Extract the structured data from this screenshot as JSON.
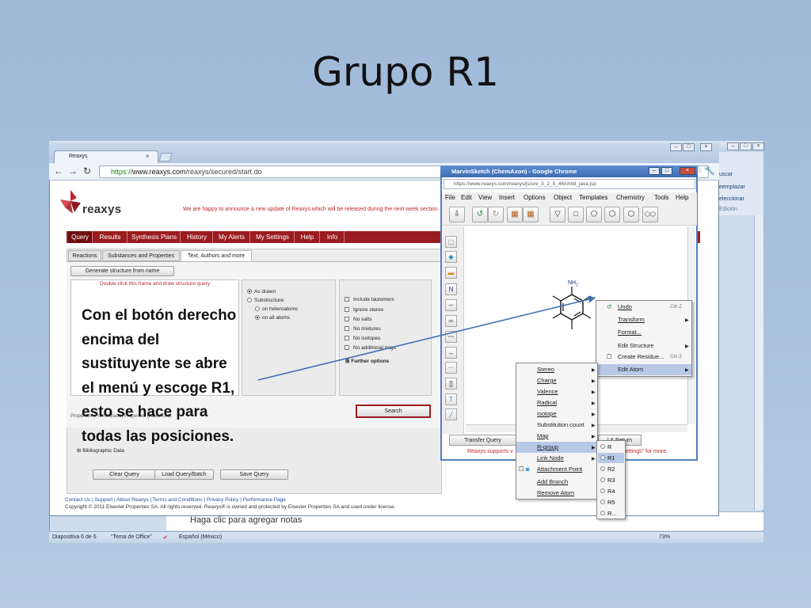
{
  "slide": {
    "title": "Grupo R1",
    "callout": "Con el botón derecho encima del sustituyente se abre el menú y escoge R1, esto se hace para todas las posiciones.",
    "notes_placeholder": "Haga clic para agregar notas"
  },
  "ppt": {
    "ribbon": [
      "uscar",
      "eemplazar",
      "eleccionar",
      "Edición"
    ],
    "status": {
      "slide": "Diapositiva 6 de 6",
      "theme": "\"Tema de Office\"",
      "language": "Español (México)",
      "zoom": "73%"
    }
  },
  "chrome": {
    "tab_label": "Reaxys",
    "url_https": "https://",
    "url_host": "www.reaxys.com",
    "url_path": "/reaxys/secured/start.do"
  },
  "reaxys": {
    "logo": "reaxys",
    "announcement": "We are happy to announce a new update of Reaxys which will be released during the next week section.",
    "nav": [
      "Query",
      "Results",
      "Synthesis Plans",
      "History",
      "My Alerts",
      "My Settings",
      "Help",
      "Info"
    ],
    "subtabs": [
      "Reactions",
      "Substances and Properties",
      "Text, Authors and more"
    ],
    "generate_btn": "Generate structure from name",
    "draw_hint": "Double click this frame and draw structure query",
    "radio_as_drawn": "As drawn",
    "radio_substructure": "Substructure:",
    "radio_on_hetero": "on heteroatoms",
    "radio_on_all": "on all atoms",
    "checks": [
      "Include tautomers",
      "Ignore stereo",
      "No salts",
      "No mixtures",
      "No isotopes",
      "No additional rings"
    ],
    "further": "Further options",
    "search_btn": "Search",
    "props_tabs": "Properties (Forms/Basic)   Properties (Advanced)",
    "tree": [
      "Bibliographic Data"
    ],
    "clear_btn": "Clear Query",
    "load_btn": "Load Query/Batch",
    "save_btn": "Save Query",
    "footer_links": "Contact Us | Support | About Reaxys | Terms and Conditions | Privacy Policy | Performance Page",
    "copyright": "Copyright © 2011 Elsevier Properties SA. All rights reserved. Reaxys® is owned and protected by Elsevier Properties SA and used under license."
  },
  "marvin": {
    "title": "MarvinSketch (ChemAxon) - Google Chrome",
    "url": "https://www.reaxys.com/reaxys/js/sre_3_2_5_46/child_java.jsp",
    "menu": [
      "File",
      "Edit",
      "View",
      "Insert",
      "Options",
      "Object",
      "Templates",
      "Chemistry",
      "Tools",
      "Help"
    ],
    "atom_label": "NH",
    "atom_sub": "2",
    "transfer_btn": "Transfer Query",
    "return_btn": "l & Return",
    "note_left": "Reaxys supports v",
    "note_right": "ettings\" for more."
  },
  "context_menu": {
    "items": [
      {
        "label": "Undo",
        "shortcut": "Ctrl-Z"
      },
      {
        "label": "Transform"
      },
      {
        "label": "Format..."
      },
      {
        "label": "Edit Structure"
      },
      {
        "label": "Create Residue...",
        "shortcut": "Ctrl-3"
      },
      {
        "label": "Edit Atom"
      }
    ]
  },
  "atom_menu": {
    "items": [
      "Stereo",
      "Charge",
      "Valence",
      "Radical",
      "Isotope",
      "Substitution count",
      "Map",
      "R-group",
      "Link Node",
      "Attachment Point",
      "Add Branch",
      "Remove Atom"
    ]
  },
  "rgroup_menu": {
    "items": [
      "R",
      "R1",
      "R2",
      "R3",
      "R4",
      "R5",
      "R..."
    ]
  }
}
